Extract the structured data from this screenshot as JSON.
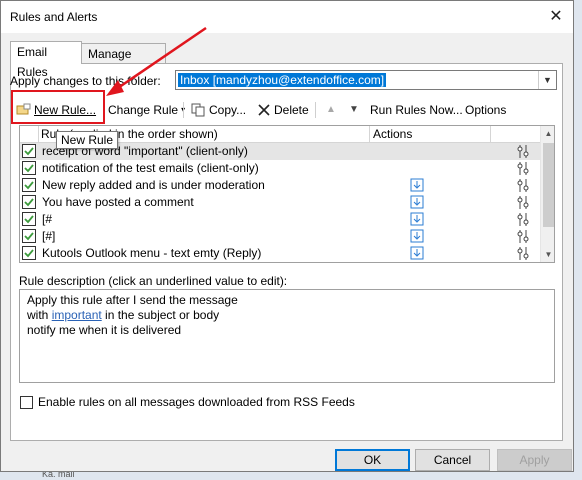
{
  "window": {
    "title": "Rules and Alerts"
  },
  "tabs": [
    {
      "label": "Email Rules"
    },
    {
      "label": "Manage Alerts"
    }
  ],
  "folder": {
    "label": "Apply changes to this folder:",
    "value": "Inbox [mandyzhou@extendoffice.com]"
  },
  "toolbar": {
    "new_rule": "New Rule...",
    "change_rule": "Change Rule",
    "copy": "Copy...",
    "delete": "Delete",
    "run_rules": "Run Rules Now...",
    "options": "Options"
  },
  "tooltip": "New Rule",
  "list": {
    "col_rule": "Rule (applied in the order shown)",
    "col_actions": "Actions",
    "rows": [
      {
        "name": "receipt of word \"important\"  (client-only)"
      },
      {
        "name": "notification of the test emails  (client-only)"
      },
      {
        "name": "New reply added and is under moderation"
      },
      {
        "name": "You have posted a comment"
      },
      {
        "name": "[#"
      },
      {
        "name": "[#]"
      },
      {
        "name": "Kutools Outlook menu - text emty (Reply)"
      }
    ]
  },
  "description": {
    "label": "Rule description (click an underlined value to edit):",
    "line1": "Apply this rule after I send the message",
    "line2_prefix": "with ",
    "line2_link": "important",
    "line2_suffix": " in the subject or body",
    "line3": "notify me when it is delivered"
  },
  "rss_label": "Enable rules on all messages downloaded from RSS Feeds",
  "buttons": {
    "ok": "OK",
    "cancel": "Cancel",
    "apply": "Apply"
  },
  "background_peek": "Ka. mail",
  "colors": {
    "highlight": "#e0161e",
    "accent": "#0078d7",
    "link": "#2a62b5"
  }
}
